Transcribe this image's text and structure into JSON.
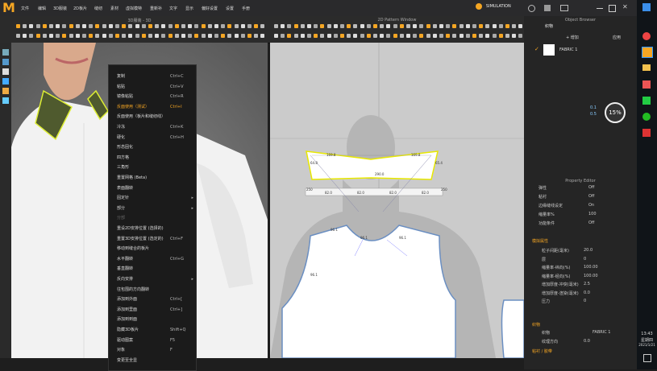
{
  "menubar": {
    "items": [
      "文件",
      "编辑",
      "3D服装",
      "2D板片",
      "缝纫",
      "素材",
      "虚拟模特",
      "重新补",
      "文字",
      "显示",
      "偏好设置",
      "设置",
      "手册"
    ],
    "simulation_label": "SIMULATION"
  },
  "viewport3d": {
    "title": "3D服装 - 3D"
  },
  "viewport2d": {
    "title": "2D Pattern Window",
    "pattern_labels": [
      "169.8",
      "169.8",
      "64.8",
      "65.4",
      "290.0",
      "82.0",
      "82.0",
      "82.0",
      "82.0",
      "250",
      "250",
      "96.1",
      "96.1",
      "96.1",
      "96.1"
    ]
  },
  "context_menu": {
    "items": [
      {
        "label": "复制",
        "shortcut": "Ctrl+C",
        "state": "normal"
      },
      {
        "label": "粘贴",
        "shortcut": "Ctrl+V",
        "state": "normal"
      },
      {
        "label": "镜像粘贴",
        "shortcut": "Ctrl+R",
        "state": "normal"
      },
      {
        "label": "反面使用（测试）",
        "shortcut": "Ctrl+I",
        "state": "highlight"
      },
      {
        "label": "反面使用（板片和缝纫线）",
        "shortcut": "",
        "state": "normal"
      },
      {
        "label": "冷冻",
        "shortcut": "Ctrl+K",
        "state": "normal"
      },
      {
        "label": "硬化",
        "shortcut": "Ctrl+H",
        "state": "normal"
      },
      {
        "label": "形态固化",
        "shortcut": "",
        "state": "normal"
      },
      {
        "label": "四方格",
        "shortcut": "",
        "state": "normal"
      },
      {
        "label": "三角形",
        "shortcut": "",
        "state": "normal"
      },
      {
        "label": "重置网格 (Beta)",
        "shortcut": "",
        "state": "normal"
      },
      {
        "label": "表面翻转",
        "shortcut": "",
        "state": "normal"
      },
      {
        "label": "固定针",
        "shortcut": "",
        "state": "submenu"
      },
      {
        "label": "部分",
        "shortcut": "",
        "state": "submenu"
      },
      {
        "label": "分部",
        "shortcut": "",
        "state": "disabled"
      },
      {
        "label": "重设2D安排位置 (选择的)",
        "shortcut": "",
        "state": "normal"
      },
      {
        "label": "重置3D安排位置 (选定的)",
        "shortcut": "Ctrl+F",
        "state": "normal"
      },
      {
        "label": "移动到缝合的板片",
        "shortcut": "",
        "state": "normal"
      },
      {
        "label": "水平翻转",
        "shortcut": "Ctrl+G",
        "state": "normal"
      },
      {
        "label": "垂直翻转",
        "shortcut": "",
        "state": "normal"
      },
      {
        "label": "反向安排",
        "shortcut": "",
        "state": "submenu"
      },
      {
        "label": "往包围的方向翻转",
        "shortcut": "",
        "state": "normal"
      },
      {
        "label": "添加到外面",
        "shortcut": "Ctrl+[",
        "state": "normal"
      },
      {
        "label": "添加到里面",
        "shortcut": "Ctrl+]",
        "state": "normal"
      },
      {
        "label": "添加到到面",
        "shortcut": "",
        "state": "normal"
      },
      {
        "label": "隐藏3D板片",
        "shortcut": "Shift+Q",
        "state": "normal"
      },
      {
        "label": "驱动图案",
        "shortcut": "F5",
        "state": "normal"
      },
      {
        "label": "对象",
        "shortcut": "F",
        "state": "normal"
      },
      {
        "label": "变更至全显",
        "shortcut": "",
        "state": "normal"
      }
    ]
  },
  "object_browser": {
    "title": "Object Browser",
    "tab": "织物",
    "add_label": "+ 增加",
    "apply_label": "应用",
    "fabric_name": "FABRIC 1",
    "percent": "15%",
    "stat1": "0.1",
    "stat2": "0.5"
  },
  "property_editor": {
    "title": "Property Editor",
    "rows": [
      {
        "label": "弹性",
        "value": "Off"
      },
      {
        "label": "粘衬",
        "value": "Off"
      },
      {
        "label": "边缘缝线设定",
        "value": "On"
      },
      {
        "label": "缩量率%",
        "value": "100"
      },
      {
        "label": "功能条件",
        "value": "Off"
      }
    ],
    "sim_section": "模拟属性",
    "sim_rows": [
      {
        "label": "粒子间距(毫米)",
        "value": "20.0"
      },
      {
        "label": "层",
        "value": "0"
      },
      {
        "label": "缩量率-纬向(%)",
        "value": "100.00"
      },
      {
        "label": "缩量率-经向(%)",
        "value": "100.00"
      },
      {
        "label": "增加厚度-冲突(毫米)",
        "value": "2.5"
      },
      {
        "label": "增加厚度-渲染(毫米)",
        "value": "0.0"
      },
      {
        "label": "压力",
        "value": "0"
      }
    ],
    "fabric_section": "织物",
    "fabric_label": "织物",
    "fabric_value": "FABRIC 1",
    "pattern_label": "纹理方向",
    "pattern_value": "0.0",
    "bottom_section": "粘衬 / 胶带"
  },
  "taskbar": {
    "time": "13:43",
    "weekday": "星期四",
    "date": "2021/1/21"
  },
  "colors": {
    "accent": "#f5a623",
    "panel": "#252525"
  }
}
